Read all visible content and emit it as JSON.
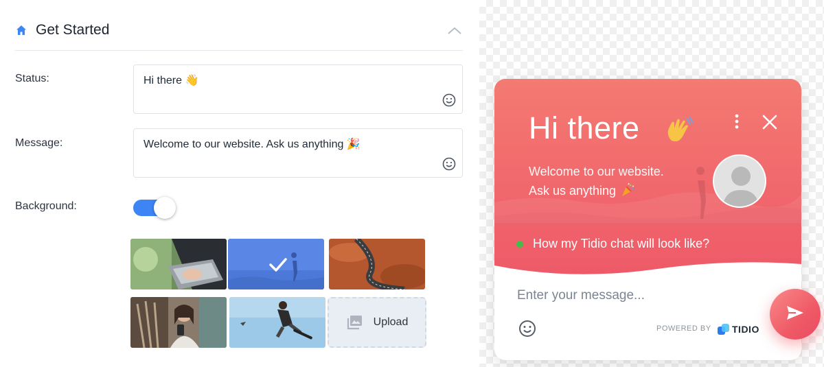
{
  "settings": {
    "section_title": "Get Started",
    "status_label": "Status:",
    "status_value": "Hi there 👋",
    "message_label": "Message:",
    "message_value": "Welcome to our website. Ask us anything 🎉",
    "background_label": "Background:",
    "background_enabled": true,
    "upload_label": "Upload",
    "selected_background_index": 1,
    "accent_color": "#3d84f5"
  },
  "widget": {
    "title": "Hi there",
    "welcome_line1": "Welcome to our website.",
    "welcome_line2": "Ask us anything",
    "question": "How my Tidio chat will look like?",
    "input_placeholder": "Enter your message...",
    "powered_by": "POWERED BY",
    "brand": "TIDIO",
    "gradient_colors": [
      "#f37a74",
      "#ee5a68"
    ],
    "online_color": "#3fbf4a"
  },
  "icons": {
    "header": "home-icon",
    "collapse": "chevron-up-icon",
    "emoji": "smiley-icon",
    "menu": "kebab-menu-icon",
    "close": "close-icon",
    "send": "send-icon",
    "upload": "image-gallery-icon"
  }
}
